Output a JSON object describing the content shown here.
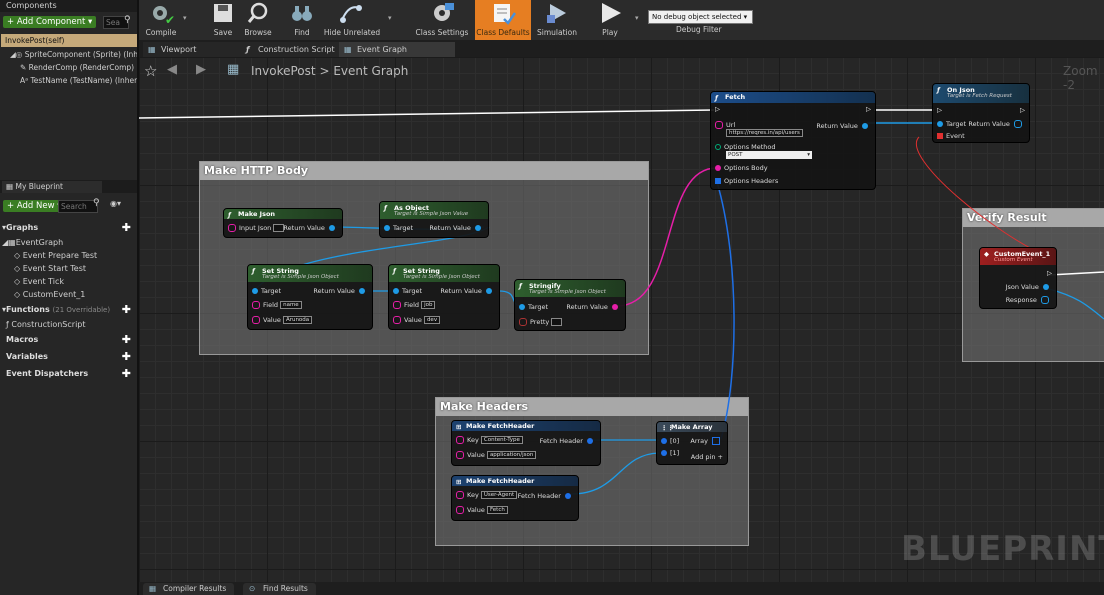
{
  "components": {
    "header": "Components",
    "add_component": "+ Add Component ▾",
    "search_placeholder": "Sea",
    "root": "InvokePost(self)",
    "items": [
      "SpriteComponent (Sprite) (Inhe",
      "RenderComp (RenderComp) (",
      "TestName (TestName) (Inher"
    ]
  },
  "my_blueprint": {
    "tab": "My Blueprint",
    "add_new": "+ Add New ▾",
    "search_placeholder": "Search",
    "graphs_label": "Graphs",
    "event_graph": "EventGraph",
    "events": [
      "Event Prepare Test",
      "Event Start Test",
      "Event Tick",
      "CustomEvent_1"
    ],
    "functions_label": "Functions",
    "functions_overridable": "(21 Overridable)",
    "construction_script": "ConstructionScript",
    "macros": "Macros",
    "variables": "Variables",
    "event_dispatchers": "Event Dispatchers"
  },
  "toolbar": {
    "compile": "Compile",
    "save": "Save",
    "browse": "Browse",
    "find": "Find",
    "hide_unrelated": "Hide Unrelated",
    "class_settings": "Class Settings",
    "class_defaults": "Class Defaults",
    "simulation": "Simulation",
    "play": "Play",
    "debug_select": "No debug object selected ▾",
    "debug_filter": "Debug Filter"
  },
  "tabs": [
    "Viewport",
    "Construction Script",
    "Event Graph"
  ],
  "breadcrumb": {
    "blueprint": "InvokePost",
    "separator": ">",
    "graph": "Event Graph"
  },
  "zoom": "Zoom -2",
  "watermark": "BLUEPRINT",
  "comments": {
    "http_body": "Make HTTP Body",
    "headers": "Make Headers",
    "verify": "Verify Result"
  },
  "nodes": {
    "fetch": {
      "title": "Fetch",
      "url_label": "Url",
      "url_value": "https://reqres.in/api/users",
      "options_method": "Options Method",
      "method_value": "POST",
      "options_body": "Options Body",
      "options_headers": "Options Headers",
      "return_value": "Return Value"
    },
    "on_json": {
      "title": "On Json",
      "subtitle": "Target is Fetch Request",
      "target": "Target",
      "return_value": "Return Value",
      "event": "Event"
    },
    "make_json": {
      "title": "Make Json",
      "input_json": "Input Json",
      "return_value": "Return Value"
    },
    "as_object": {
      "title": "As Object",
      "subtitle": "Target is Simple Json Value",
      "target": "Target",
      "return_value": "Return Value"
    },
    "set_string_1": {
      "title": "Set String",
      "subtitle": "Target is Simple Json Object",
      "target": "Target",
      "return_value": "Return Value",
      "field": "Field",
      "field_value": "name",
      "value": "Value",
      "value_value": "Arunoda"
    },
    "set_string_2": {
      "title": "Set String",
      "subtitle": "Target is Simple Json Object",
      "target": "Target",
      "return_value": "Return Value",
      "field": "Field",
      "field_value": "job",
      "value": "Value",
      "value_value": "dev"
    },
    "stringify": {
      "title": "Stringify",
      "subtitle": "Target is Simple Json Object",
      "target": "Target",
      "return_value": "Return Value",
      "pretty": "Pretty"
    },
    "custom_event": {
      "title": "CustomEvent_1",
      "subtitle": "Custom Event",
      "json_value": "Json Value",
      "response": "Response"
    },
    "fetch_header_1": {
      "title": "Make FetchHeader",
      "key": "Key",
      "key_value": "Content-Type",
      "value": "Value",
      "value_value": "application/json",
      "out": "Fetch Header"
    },
    "fetch_header_2": {
      "title": "Make FetchHeader",
      "key": "Key",
      "key_value": "User-Agent",
      "value": "Value",
      "value_value": "Fetch",
      "out": "Fetch Header"
    },
    "make_array": {
      "title": "Make Array",
      "in0": "[0]",
      "in1": "[1]",
      "array": "Array",
      "add_pin": "Add pin +"
    }
  },
  "bottom_tabs": [
    "Compiler Results",
    "Find Results"
  ],
  "colors": {
    "accent_orange": "#e67e22",
    "green": "#3a7d23",
    "exec": "#ffffff",
    "object_pin": "#1e9be6",
    "string_pin": "#e61ea8"
  }
}
